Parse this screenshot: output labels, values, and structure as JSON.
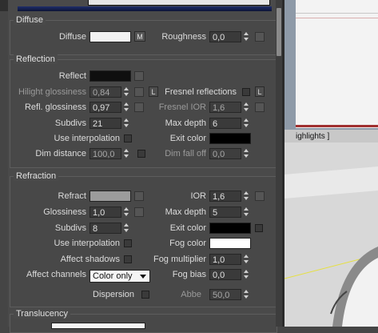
{
  "diffuse": {
    "title": "Diffuse",
    "diffuse_label": "Diffuse",
    "diffuse_color": "#f2f2f2",
    "m_button": "M",
    "roughness_label": "Roughness",
    "roughness_value": "0,0"
  },
  "reflection": {
    "title": "Reflection",
    "reflect_label": "Reflect",
    "reflect_color": "#0f0f0f",
    "hilight_label": "Hilight glossiness",
    "hilight_value": "0,84",
    "l_button": "L",
    "fresnel_label": "Fresnel reflections",
    "refl_gloss_label": "Refl. glossiness",
    "refl_gloss_value": "0,97",
    "fresnel_ior_label": "Fresnel IOR",
    "fresnel_ior_value": "1,6",
    "subdivs_label": "Subdivs",
    "subdivs_value": "21",
    "max_depth_label": "Max depth",
    "max_depth_value": "6",
    "use_interp_label": "Use interpolation",
    "exit_color_label": "Exit color",
    "exit_color": "#000000",
    "dim_distance_label": "Dim distance",
    "dim_distance_value": "100,0",
    "dim_falloff_label": "Dim fall off",
    "dim_falloff_value": "0,0"
  },
  "refraction": {
    "title": "Refraction",
    "refract_label": "Refract",
    "refract_color": "#9c9c9c",
    "ior_label": "IOR",
    "ior_value": "1,6",
    "glossiness_label": "Glossiness",
    "glossiness_value": "1,0",
    "max_depth_label": "Max depth",
    "max_depth_value": "5",
    "subdivs_label": "Subdivs",
    "subdivs_value": "8",
    "exit_color_label": "Exit color",
    "exit_color": "#000000",
    "use_interp_label": "Use interpolation",
    "fog_color_label": "Fog color",
    "fog_color": "#ffffff",
    "affect_shadows_label": "Affect shadows",
    "fog_multiplier_label": "Fog multiplier",
    "fog_multiplier_value": "1,0",
    "affect_channels_label": "Affect channels",
    "affect_channels_value": "Color only",
    "fog_bias_label": "Fog bias",
    "fog_bias_value": "0,0",
    "dispersion_label": "Dispersion",
    "abbe_label": "Abbe",
    "abbe_value": "50,0"
  },
  "translucency": {
    "title": "Translucency"
  },
  "viewport": {
    "label": "ighlights ]"
  }
}
